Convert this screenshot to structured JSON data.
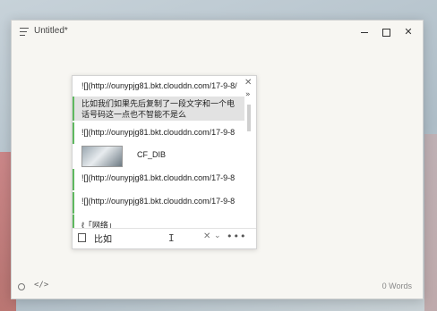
{
  "window": {
    "title": "Untitled*",
    "minimize_icon": "minimize-icon",
    "maximize_icon": "maximize-icon",
    "close_glyph": "✕"
  },
  "statusbar": {
    "code_label": "</>",
    "word_count": "0 Words"
  },
  "clipboard": {
    "items": [
      {
        "text": "![](http://ounypjg81.bkt.clouddn.com/17-9-8/"
      },
      {
        "text": "比如我们如果先后复制了一段文字和一个电话号码这一点也不智能不是么",
        "selected": true
      },
      {
        "text": "![](http://ounypjg81.bkt.clouddn.com/17-9-8"
      },
      {
        "text": "CF_DIB",
        "thumbnail_icon": "screenshot-thumbnail"
      },
      {
        "text": "![](http://ounypjg81.bkt.clouddn.com/17-9-8"
      },
      {
        "text": "![](http://ounypjg81.bkt.clouddn.com/17-9-8"
      },
      {
        "text": "ℓ「网络」"
      }
    ],
    "side": {
      "close_glyph": "✕",
      "collapse_glyph": "»"
    },
    "search": {
      "value": "比如",
      "clear_glyph": "✕",
      "dropdown_glyph": "⌄",
      "more_glyph": "•••",
      "cursor_glyph": "I"
    },
    "accent": "#5fb85f"
  }
}
